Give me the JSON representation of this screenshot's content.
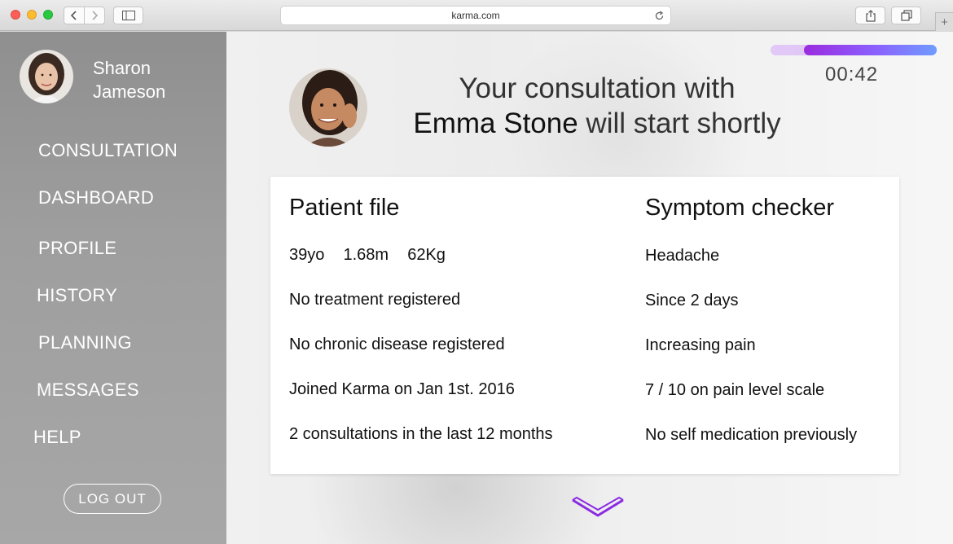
{
  "browser": {
    "url": "karma.com"
  },
  "user": {
    "first_name": "Sharon",
    "last_name": "Jameson"
  },
  "nav": {
    "items": [
      {
        "label": "CONSULTATION"
      },
      {
        "label": "DASHBOARD"
      },
      {
        "label": "PROFILE"
      },
      {
        "label": "HISTORY"
      },
      {
        "label": "PLANNING"
      },
      {
        "label": "MESSAGES"
      },
      {
        "label": "HELP"
      }
    ],
    "logout_label": "LOG OUT"
  },
  "consultation": {
    "timer": "00:42",
    "progress": 0.8,
    "headline_prefix": "Your consultation with",
    "doctor_name": "Emma Stone",
    "headline_suffix": " will start shortly"
  },
  "patient_file": {
    "title": "Patient file",
    "age": "39yo",
    "height": "1.68m",
    "weight": "62Kg",
    "lines": [
      "No treatment registered",
      "No chronic disease registered",
      "Joined Karma on Jan 1st. 2016",
      "2 consultations in the last 12 months"
    ]
  },
  "symptom_checker": {
    "title": "Symptom checker",
    "lines": [
      "Headache",
      "Since 2 days",
      "Increasing pain",
      "7 / 10 on pain level scale",
      "No self medication previously"
    ]
  },
  "colors": {
    "accent": "#9b2bdf",
    "accent_end": "#6f9cff"
  },
  "icons": {
    "back": "chevron-left-icon",
    "forward": "chevron-right-icon",
    "sidebar": "sidebar-icon",
    "reload": "reload-icon",
    "share": "share-icon",
    "tabs": "tabs-icon",
    "new_tab": "plus-icon",
    "scroll": "chevron-down-icon"
  }
}
